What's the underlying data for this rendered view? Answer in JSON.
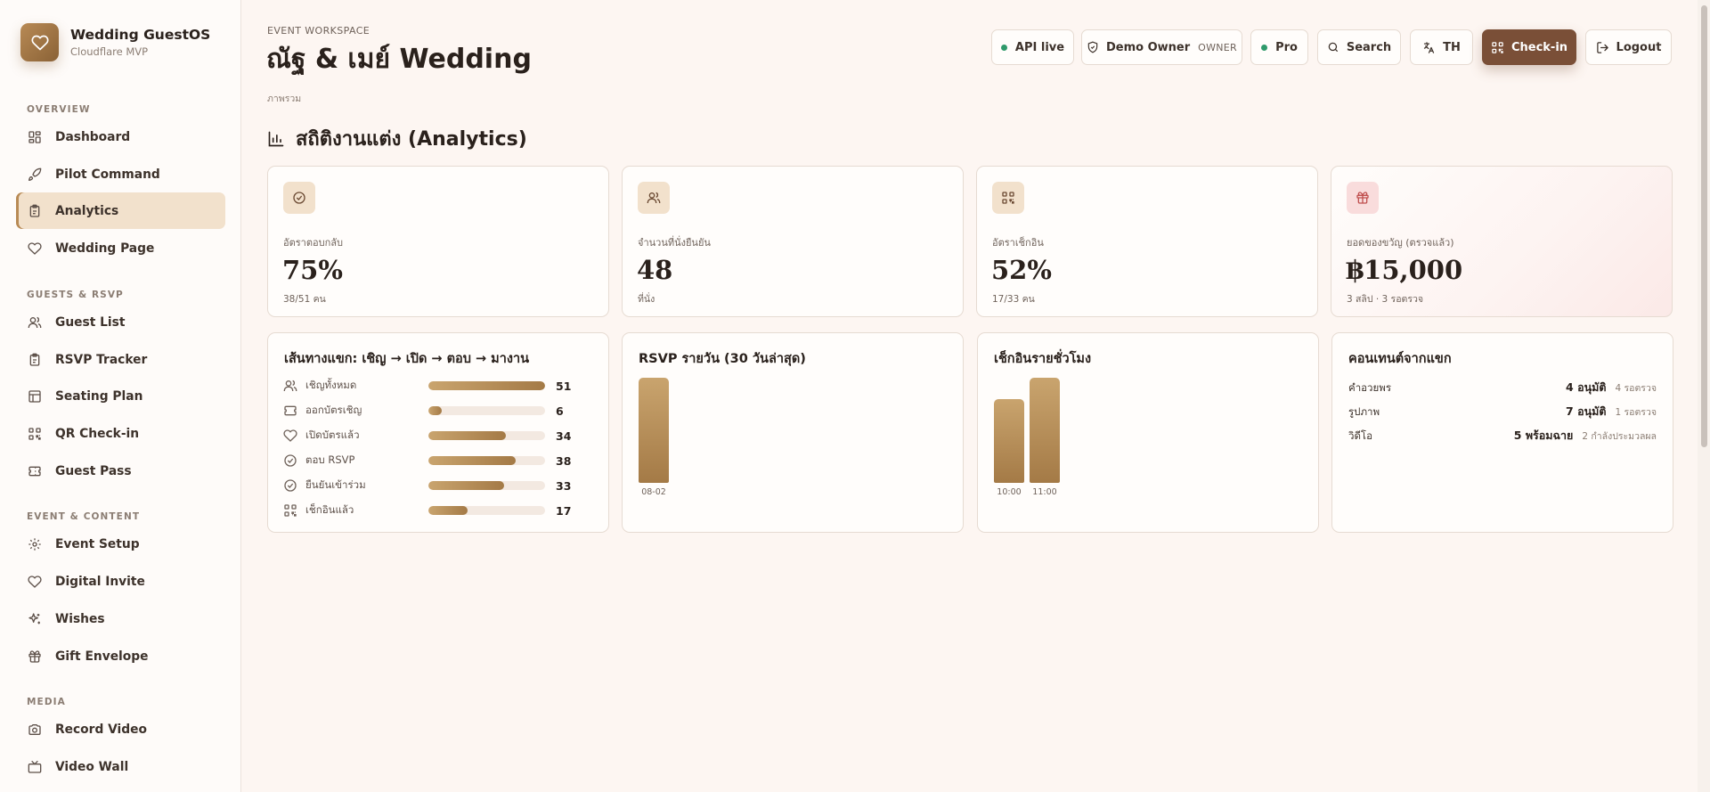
{
  "brand": {
    "name": "Wedding GuestOS",
    "subtitle": "Cloudflare MVP"
  },
  "sidebar": {
    "sections": [
      {
        "title": "OVERVIEW"
      },
      {
        "title": "GUESTS & RSVP"
      },
      {
        "title": "EVENT & CONTENT"
      },
      {
        "title": "MEDIA"
      }
    ],
    "items": [
      {
        "label": "Dashboard",
        "icon": "dashboard-icon"
      },
      {
        "label": "Pilot Command",
        "icon": "rocket-icon"
      },
      {
        "label": "Analytics",
        "icon": "clipboard-icon",
        "active": true
      },
      {
        "label": "Wedding Page",
        "icon": "heart-icon"
      },
      {
        "label": "Guest List",
        "icon": "users-icon"
      },
      {
        "label": "RSVP Tracker",
        "icon": "clipboard-icon"
      },
      {
        "label": "Seating Plan",
        "icon": "table-icon"
      },
      {
        "label": "QR Check-in",
        "icon": "qr-icon"
      },
      {
        "label": "Guest Pass",
        "icon": "ticket-icon"
      },
      {
        "label": "Event Setup",
        "icon": "gear-icon"
      },
      {
        "label": "Digital Invite",
        "icon": "heart-icon"
      },
      {
        "label": "Wishes",
        "icon": "sparkle-icon"
      },
      {
        "label": "Gift Envelope",
        "icon": "gift-icon"
      },
      {
        "label": "Record Video",
        "icon": "camera-icon"
      },
      {
        "label": "Video Wall",
        "icon": "tv-icon"
      }
    ]
  },
  "header": {
    "eyebrow": "EVENT WORKSPACE",
    "title": "ณัฐ & เมย์ Wedding",
    "breadcrumb": "ภาพรวม",
    "buttons": {
      "api": "API live",
      "user": "Demo Owner",
      "role": "OWNER",
      "plan": "Pro",
      "search": "Search",
      "lang": "TH",
      "checkin": "Check-in",
      "logout": "Logout"
    }
  },
  "section_title": "สถิติงานแต่ง (Analytics)",
  "stats": [
    {
      "label": "อัตราตอบกลับ",
      "value": "75%",
      "sub": "38/51 คน",
      "icon": "check-circle-icon"
    },
    {
      "label": "จำนวนที่นั่งยืนยัน",
      "value": "48",
      "sub": "ที่นั่ง",
      "icon": "users-icon"
    },
    {
      "label": "อัตราเช็กอิน",
      "value": "52%",
      "sub": "17/33 คน",
      "icon": "qr-icon"
    },
    {
      "label": "ยอดของขวัญ (ตรวจแล้ว)",
      "value": "฿15,000",
      "sub": "3 สลิป · 3 รอตรวจ",
      "icon": "gift-icon"
    }
  ],
  "funnel": {
    "title": "เส้นทางแขก: เชิญ → เปิด → ตอบ → มางาน",
    "max": 51,
    "rows": [
      {
        "label": "เชิญทั้งหมด",
        "value": 51,
        "icon": "users-icon"
      },
      {
        "label": "ออกบัตรเชิญ",
        "value": 6,
        "icon": "ticket-icon"
      },
      {
        "label": "เปิดบัตรแล้ว",
        "value": 34,
        "icon": "heart-icon"
      },
      {
        "label": "ตอบ RSVP",
        "value": 38,
        "icon": "check-circle-icon"
      },
      {
        "label": "ยืนยันเข้าร่วม",
        "value": 33,
        "icon": "check-circle-icon"
      },
      {
        "label": "เช็กอินแล้ว",
        "value": 17,
        "icon": "qr-icon"
      }
    ]
  },
  "rsvp_daily": {
    "title": "RSVP รายวัน (30 วันล่าสุด)",
    "labels": [
      "08-02"
    ],
    "relative": [
      1.0
    ]
  },
  "checkin_hourly": {
    "title": "เช็กอินรายชั่วโมง",
    "labels": [
      "10:00",
      "11:00"
    ],
    "relative": [
      0.8,
      1.0
    ]
  },
  "content": {
    "title": "คอนเทนต์จากแขก",
    "rows": [
      {
        "name": "คำอวยพร",
        "ok": "4 อนุมัติ",
        "pending": "4 รอตรวจ"
      },
      {
        "name": "รูปภาพ",
        "ok": "7 อนุมัติ",
        "pending": "1 รอตรวจ"
      },
      {
        "name": "วิดีโอ",
        "ok": "5 พร้อมฉาย",
        "pending": "2 กำลังประมวลผล"
      }
    ]
  }
}
